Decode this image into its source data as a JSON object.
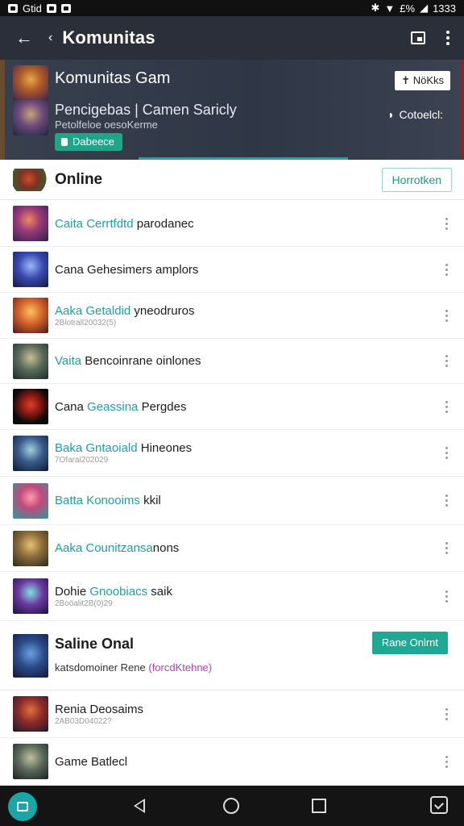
{
  "status_bar": {
    "carrier": "Gtid",
    "battery": "£%",
    "time": "1333"
  },
  "app_bar": {
    "title": "Komunitas",
    "back_icon": "arrow-left-icon",
    "chevron_icon": "chevron-left-icon"
  },
  "hero": {
    "title": "Komunitas Gam",
    "subtitle": "Pencigebas | Camen Saricly",
    "description": "Petolfeloe oesoKerme",
    "badge": "Dabeece",
    "action_label": "NöKks",
    "notification_label": "Cotoelcl:"
  },
  "online": {
    "heading": "Online",
    "action_label": "Horrotken"
  },
  "rows": [
    {
      "prefix": "Caita",
      "highlight": "Cerrtfdtd",
      "rest": "parodanec",
      "meta": ""
    },
    {
      "prefix": "Cana",
      "highlight": "",
      "rest": "Gehesimers amplors",
      "meta": ""
    },
    {
      "prefix": "Aaka",
      "highlight": "Getaldid",
      "rest": "yneodruros",
      "meta": "2Blotrall20032(5)"
    },
    {
      "prefix": "Vaita",
      "highlight": "",
      "rest": "Bencoinrane oinlones",
      "meta": ""
    },
    {
      "prefix": "Cana",
      "highlight": "Geassina",
      "rest": "Pergdes",
      "meta": ""
    },
    {
      "prefix": "Baka",
      "highlight": "Gntaoiald",
      "rest": "Hineones",
      "meta": "7Ofaral202029"
    },
    {
      "prefix": "Batta",
      "highlight": "Konooims",
      "rest": "kkil",
      "meta": ""
    },
    {
      "prefix": "Aaka",
      "highlight": "Counitzansa",
      "rest": "nons",
      "meta": ""
    },
    {
      "prefix": "Dohie",
      "highlight": "Gnoobiacs",
      "rest": "saik",
      "meta": "2Boöalit2B(0)29"
    }
  ],
  "saline": {
    "title": "Saline Onal",
    "description": "katsdomoiner Rene",
    "description_highlight": "(forcdKtehne)",
    "action_label": "Rane Onlrnt"
  },
  "bottom_rows": [
    {
      "text": "Renia Deosaims",
      "meta": "2AB03D04022?"
    },
    {
      "text": "Game Batlecl",
      "meta": ""
    }
  ],
  "colors": {
    "accent": "#1fa0a0",
    "app_bar": "#2b2f3a",
    "badge": "#1fa688",
    "highlight_pink": "#b03ab8"
  }
}
